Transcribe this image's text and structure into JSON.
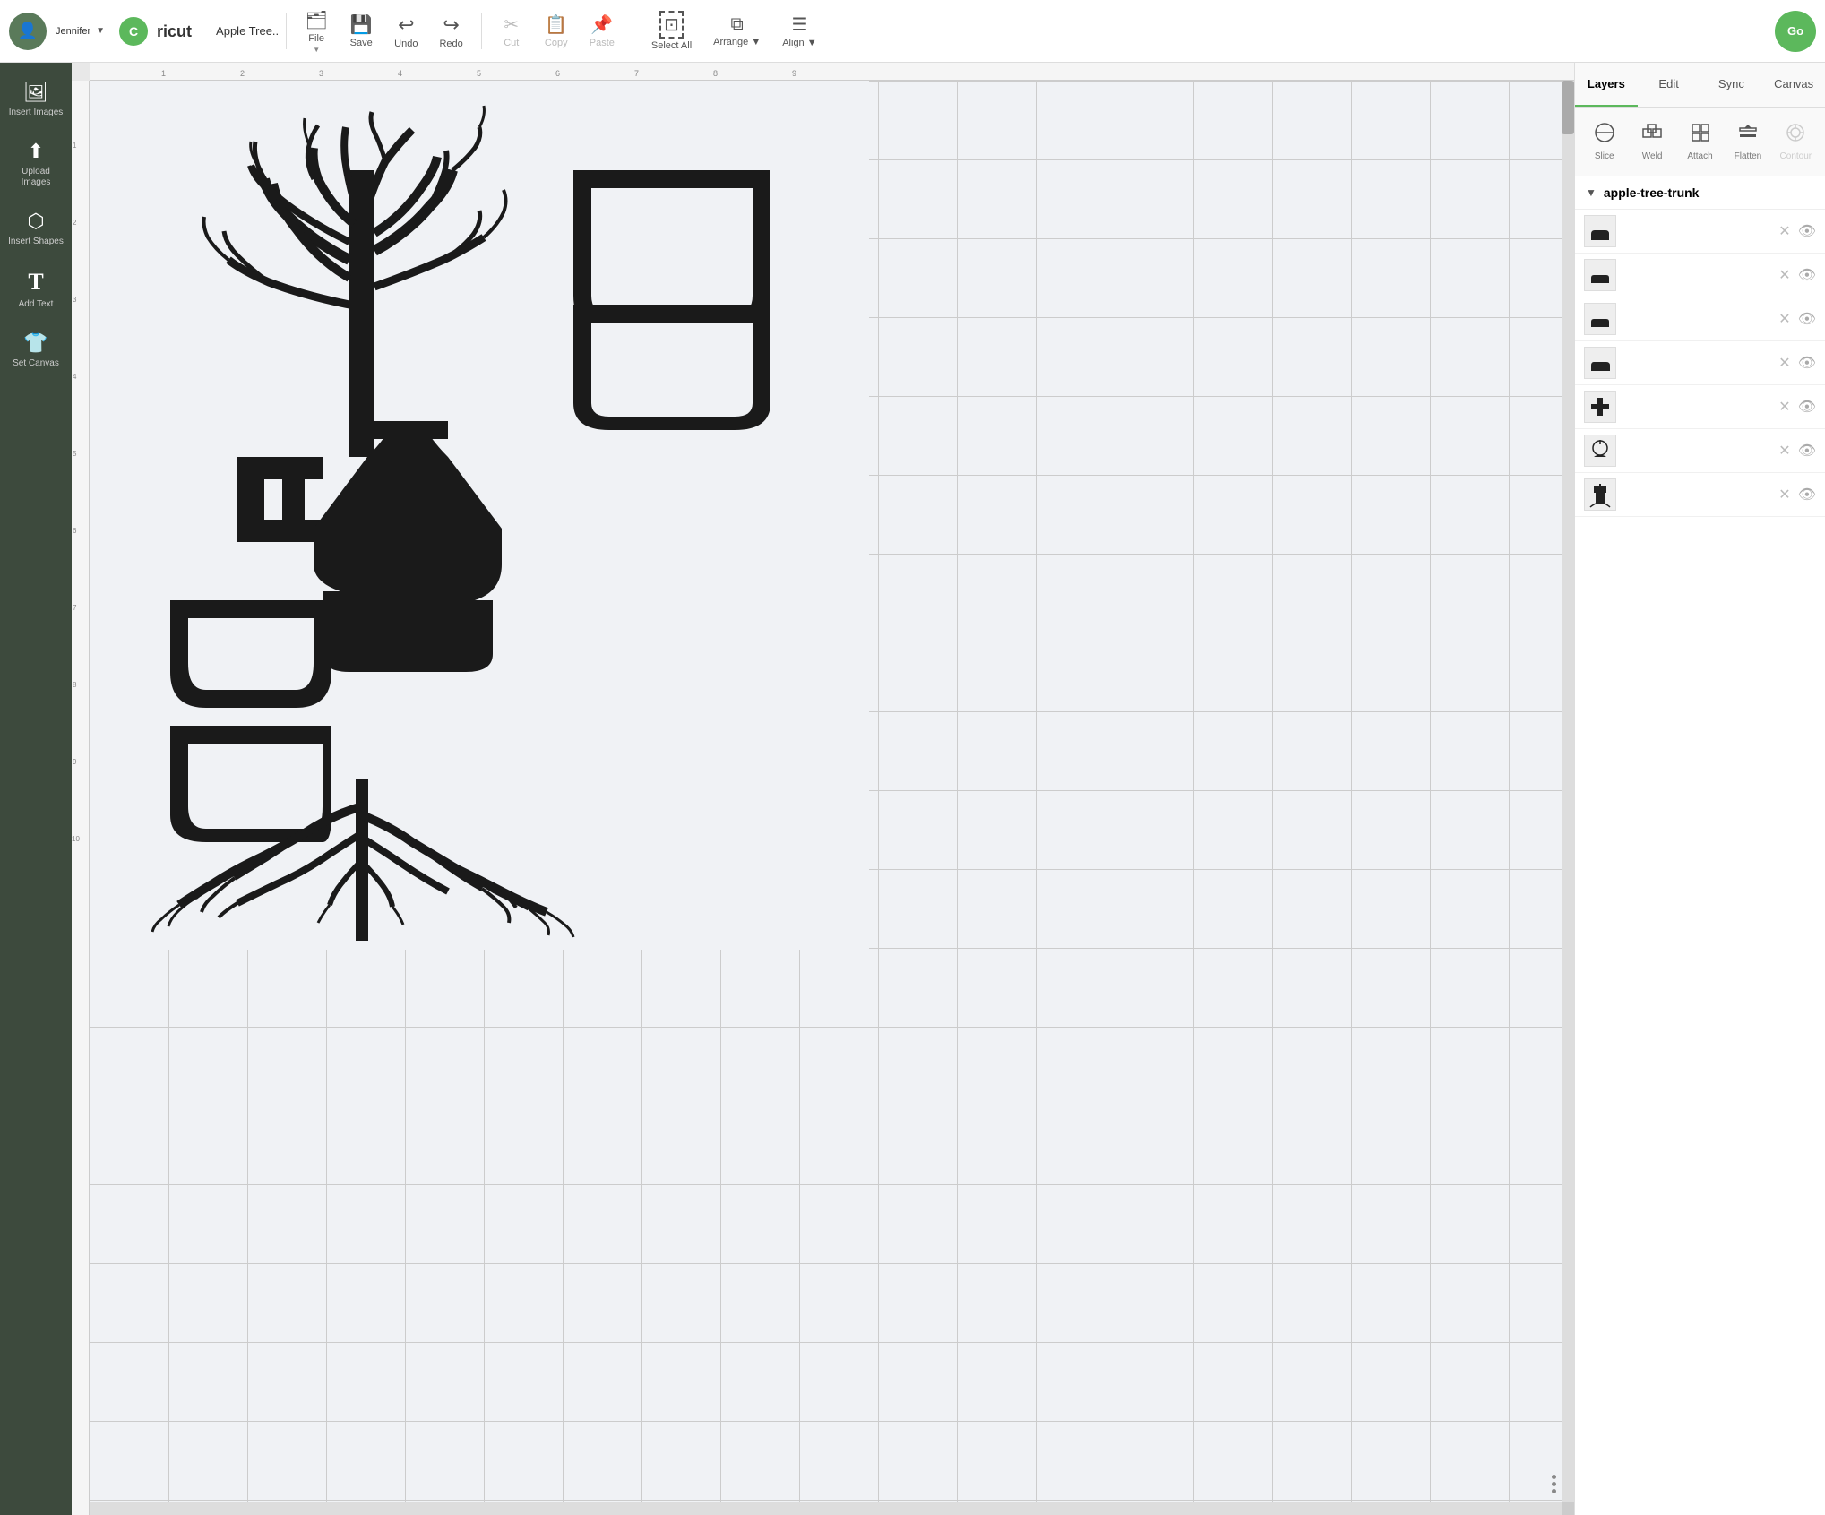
{
  "app": {
    "title": "Apple Tree..",
    "go_label": "Go"
  },
  "user": {
    "name": "Jennifer",
    "avatar_char": "👤"
  },
  "toolbar": {
    "items": [
      {
        "id": "file",
        "icon": "🗂",
        "label": "File",
        "has_arrow": true,
        "disabled": false
      },
      {
        "id": "save",
        "icon": "💾",
        "label": "Save",
        "disabled": false
      },
      {
        "id": "undo",
        "icon": "↩",
        "label": "Undo",
        "disabled": false
      },
      {
        "id": "redo",
        "icon": "↪",
        "label": "Redo",
        "disabled": false
      },
      {
        "id": "cut",
        "icon": "✂",
        "label": "Cut",
        "disabled": true
      },
      {
        "id": "copy",
        "icon": "📋",
        "label": "Copy",
        "disabled": true
      },
      {
        "id": "paste",
        "icon": "📌",
        "label": "Paste",
        "disabled": true
      },
      {
        "id": "select-all",
        "icon": "⬚",
        "label": "Select All",
        "disabled": false
      },
      {
        "id": "arrange",
        "icon": "⧉",
        "label": "Arrange",
        "has_arrow": true,
        "disabled": false
      },
      {
        "id": "align",
        "icon": "☰",
        "label": "Align",
        "has_arrow": true,
        "disabled": false
      }
    ]
  },
  "left_sidebar": {
    "items": [
      {
        "id": "insert-images",
        "icon": "🖼",
        "label": "Insert\nImages"
      },
      {
        "id": "upload-images",
        "icon": "⬆",
        "label": "Upload\nImages"
      },
      {
        "id": "insert-shapes",
        "icon": "⬡",
        "label": "Insert\nShapes"
      },
      {
        "id": "add-text",
        "icon": "T",
        "label": "Add Text"
      },
      {
        "id": "set-canvas",
        "icon": "👕",
        "label": "Set Canvas"
      }
    ]
  },
  "right_panel": {
    "tabs": [
      "Layers",
      "Edit",
      "Sync",
      "Canvas"
    ],
    "active_tab": "Layers",
    "actions": [
      {
        "id": "slice",
        "label": "Slice",
        "disabled": false
      },
      {
        "id": "weld",
        "label": "Weld",
        "disabled": false
      },
      {
        "id": "attach",
        "label": "Attach",
        "disabled": false
      },
      {
        "id": "flatten",
        "label": "Flatten",
        "disabled": false
      },
      {
        "id": "contour",
        "label": "Contour",
        "disabled": true
      }
    ],
    "group_name": "apple-tree-trunk",
    "layers": [
      {
        "id": 1,
        "visible": true
      },
      {
        "id": 2,
        "visible": true
      },
      {
        "id": 3,
        "visible": true
      },
      {
        "id": 4,
        "visible": true
      },
      {
        "id": 5,
        "visible": true
      },
      {
        "id": 6,
        "visible": true
      },
      {
        "id": 7,
        "visible": true
      }
    ]
  },
  "rulers": {
    "horizontal": [
      1,
      2,
      3,
      4,
      5,
      6,
      7,
      8,
      9
    ],
    "vertical": [
      1,
      2,
      3,
      4,
      5,
      6,
      7,
      8,
      9,
      10
    ]
  }
}
